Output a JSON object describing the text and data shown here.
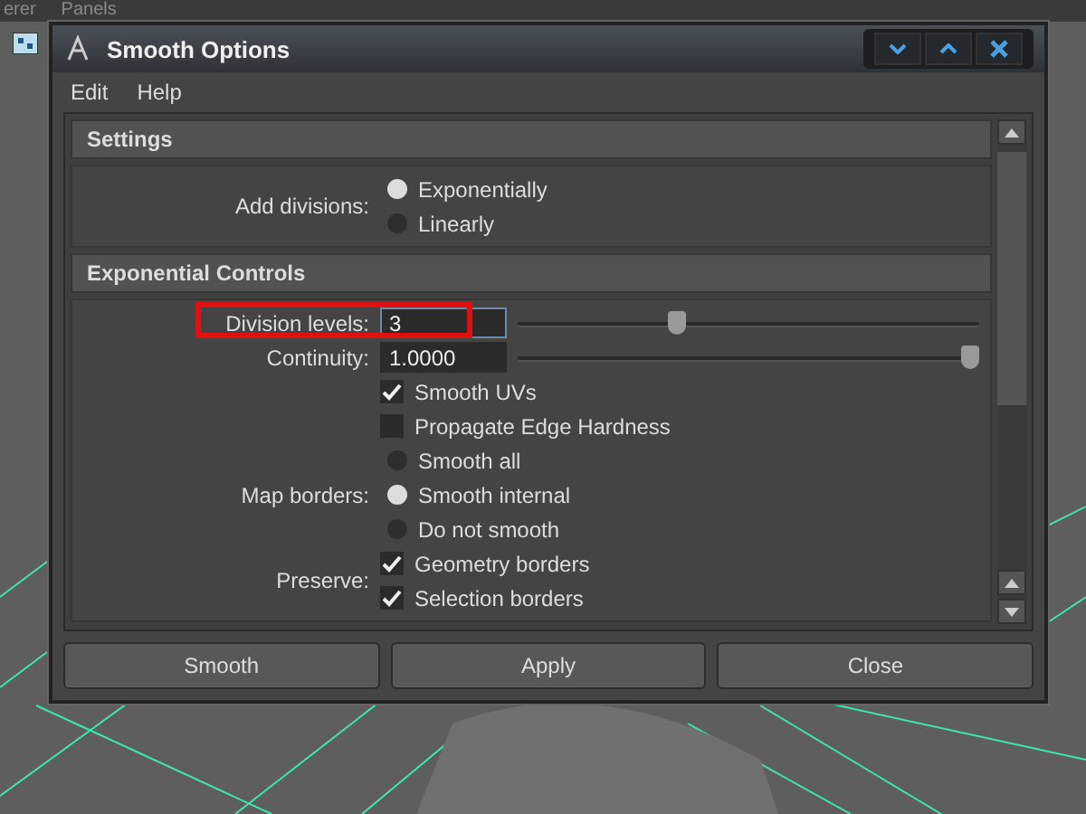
{
  "background_menu": [
    "erer",
    "Panels"
  ],
  "window": {
    "title": "Smooth Options"
  },
  "menu": [
    "Edit",
    "Help"
  ],
  "sections": [
    {
      "title": "Settings",
      "rows": [
        {
          "kind": "radio",
          "label": "Add divisions:",
          "options": [
            {
              "label": "Exponentially",
              "selected": true
            },
            {
              "label": "Linearly",
              "selected": false
            }
          ]
        }
      ]
    },
    {
      "title": "Exponential Controls",
      "rows": [
        {
          "kind": "slider",
          "label": "Division levels:",
          "value": "3",
          "level": 0.34,
          "highlighted": true
        },
        {
          "kind": "slider",
          "label": "Continuity:",
          "value": "1.0000",
          "level": 1,
          "highlighted": false
        },
        {
          "kind": "checkbox",
          "options": [
            {
              "label": "Smooth UVs",
              "checked": true
            },
            {
              "label": "Propagate Edge Hardness",
              "checked": false
            }
          ]
        },
        {
          "kind": "radio",
          "label": "Map borders:",
          "options": [
            {
              "label": "Smooth all",
              "selected": false
            },
            {
              "label": "Smooth internal",
              "selected": true
            },
            {
              "label": "Do not smooth",
              "selected": false
            }
          ]
        },
        {
          "kind": "checkbox",
          "label": "Preserve:",
          "options": [
            {
              "label": "Geometry borders",
              "checked": true
            },
            {
              "label": "Selection borders",
              "checked": true
            }
          ]
        }
      ]
    }
  ],
  "buttons": [
    "Smooth",
    "Apply",
    "Close"
  ]
}
